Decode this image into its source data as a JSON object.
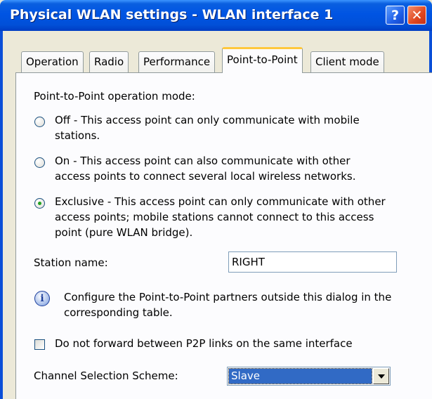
{
  "window": {
    "title": "Physical WLAN settings - WLAN interface 1",
    "help_button": "?",
    "close_button": "✕"
  },
  "tabs": [
    {
      "label": "Operation",
      "active": false
    },
    {
      "label": "Radio",
      "active": false
    },
    {
      "label": "Performance",
      "active": false
    },
    {
      "label": "Point-to-Point",
      "active": true
    },
    {
      "label": "Client mode",
      "active": false
    }
  ],
  "p2p": {
    "mode_heading": "Point-to-Point operation mode:",
    "options": [
      {
        "lines": [
          "Off - This access point can only communicate with mobile",
          "stations."
        ],
        "selected": false
      },
      {
        "lines": [
          "On - This access point can also communicate with other",
          "access points to connect several local wireless networks."
        ],
        "selected": false
      },
      {
        "lines": [
          "Exclusive - This access point can only communicate with other",
          "access points; mobile stations cannot connect to this access",
          "point (pure WLAN bridge)."
        ],
        "selected": true
      }
    ],
    "station_name_label": "Station name:",
    "station_name_value": "RIGHT",
    "info_icon": "info-icon",
    "info_lines": [
      "Configure the Point-to-Point partners outside this dialog in the",
      "corresponding table."
    ],
    "no_forward_label": "Do not forward between P2P links on the same interface",
    "no_forward_checked": false,
    "channel_scheme_label": "Channel Selection Scheme:",
    "channel_scheme_value": "Slave"
  }
}
